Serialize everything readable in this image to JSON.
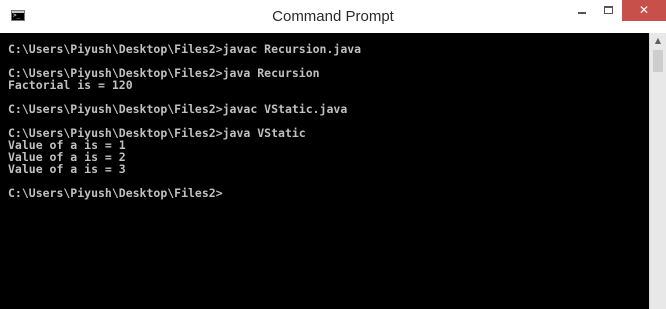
{
  "window": {
    "title": "Command Prompt",
    "icon": "cmd-icon",
    "close_glyph": "✕"
  },
  "console": {
    "background": "#000000",
    "foreground": "#c0c0c0",
    "lines": [
      "C:\\Users\\Piyush\\Desktop\\Files2>javac Recursion.java",
      "",
      "C:\\Users\\Piyush\\Desktop\\Files2>java Recursion",
      "Factorial is = 120",
      "",
      "C:\\Users\\Piyush\\Desktop\\Files2>javac VStatic.java",
      "",
      "C:\\Users\\Piyush\\Desktop\\Files2>java VStatic",
      "Value of a is = 1",
      "Value of a is = 2",
      "Value of a is = 3",
      "",
      "C:\\Users\\Piyush\\Desktop\\Files2>"
    ]
  },
  "colors": {
    "close_button": "#c7504a",
    "titlebar": "#ffffff"
  }
}
